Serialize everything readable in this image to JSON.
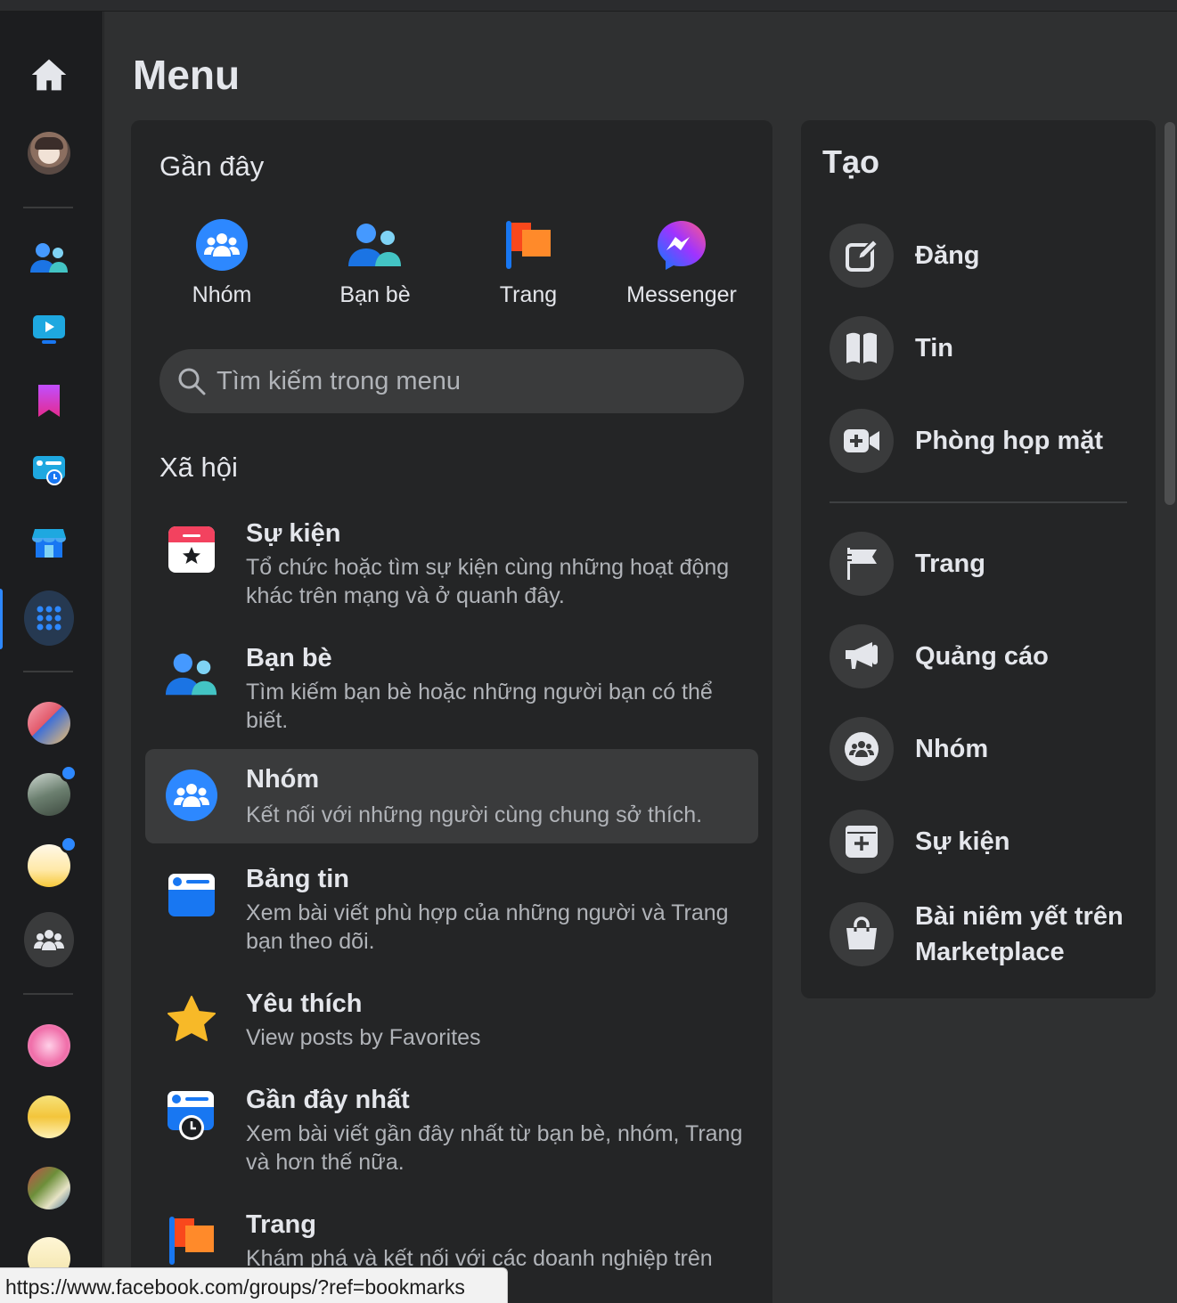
{
  "page": {
    "title": "Menu"
  },
  "recent": {
    "title": "Gần đây",
    "items": [
      {
        "label": "Nhóm",
        "icon": "groups-icon"
      },
      {
        "label": "Bạn bè",
        "icon": "friends-icon"
      },
      {
        "label": "Trang",
        "icon": "pages-flag-icon"
      },
      {
        "label": "Messenger",
        "icon": "messenger-icon"
      }
    ]
  },
  "search": {
    "placeholder": "Tìm kiếm trong menu"
  },
  "social": {
    "title": "Xã hội",
    "items": [
      {
        "title": "Sự kiện",
        "desc": "Tổ chức hoặc tìm sự kiện cùng những hoạt động khác trên mạng và ở quanh đây.",
        "icon": "events-calendar-icon"
      },
      {
        "title": "Bạn bè",
        "desc": "Tìm kiếm bạn bè hoặc những người bạn có thể biết.",
        "icon": "friends-icon"
      },
      {
        "title": "Nhóm",
        "desc": "Kết nối với những người cùng chung sở thích.",
        "icon": "groups-icon"
      },
      {
        "title": "Bảng tin",
        "desc": "Xem bài viết phù hợp của những người và Trang bạn theo dõi.",
        "icon": "feed-icon"
      },
      {
        "title": "Yêu thích",
        "desc": "View posts by Favorites",
        "icon": "star-icon"
      },
      {
        "title": "Gần đây nhất",
        "desc": "Xem bài viết gần đây nhất từ bạn bè, nhóm, Trang và hơn thế nữa.",
        "icon": "recent-feed-clock-icon"
      },
      {
        "title": "Trang",
        "desc": "Khám phá và kết nối với các doanh nghiệp trên",
        "icon": "pages-flag-icon"
      }
    ]
  },
  "create": {
    "title": "Tạo",
    "items": [
      {
        "label": "Đăng",
        "icon": "compose-icon"
      },
      {
        "label": "Tin",
        "icon": "story-book-icon"
      },
      {
        "label": "Phòng họp mặt",
        "icon": "video-room-icon"
      },
      {
        "label": "Trang",
        "icon": "flag-icon"
      },
      {
        "label": "Quảng cáo",
        "icon": "megaphone-icon"
      },
      {
        "label": "Nhóm",
        "icon": "group-icon"
      },
      {
        "label": "Sự kiện",
        "icon": "event-plus-icon"
      },
      {
        "label": "Bài niêm yết trên Marketplace",
        "icon": "shopping-bag-icon"
      }
    ]
  },
  "status_bar": {
    "url": "https://www.facebook.com/groups/?ref=bookmarks"
  },
  "colors": {
    "accent": "#2d88ff",
    "card": "#242526",
    "background": "#2f3031",
    "rail": "#1c1d1f"
  }
}
